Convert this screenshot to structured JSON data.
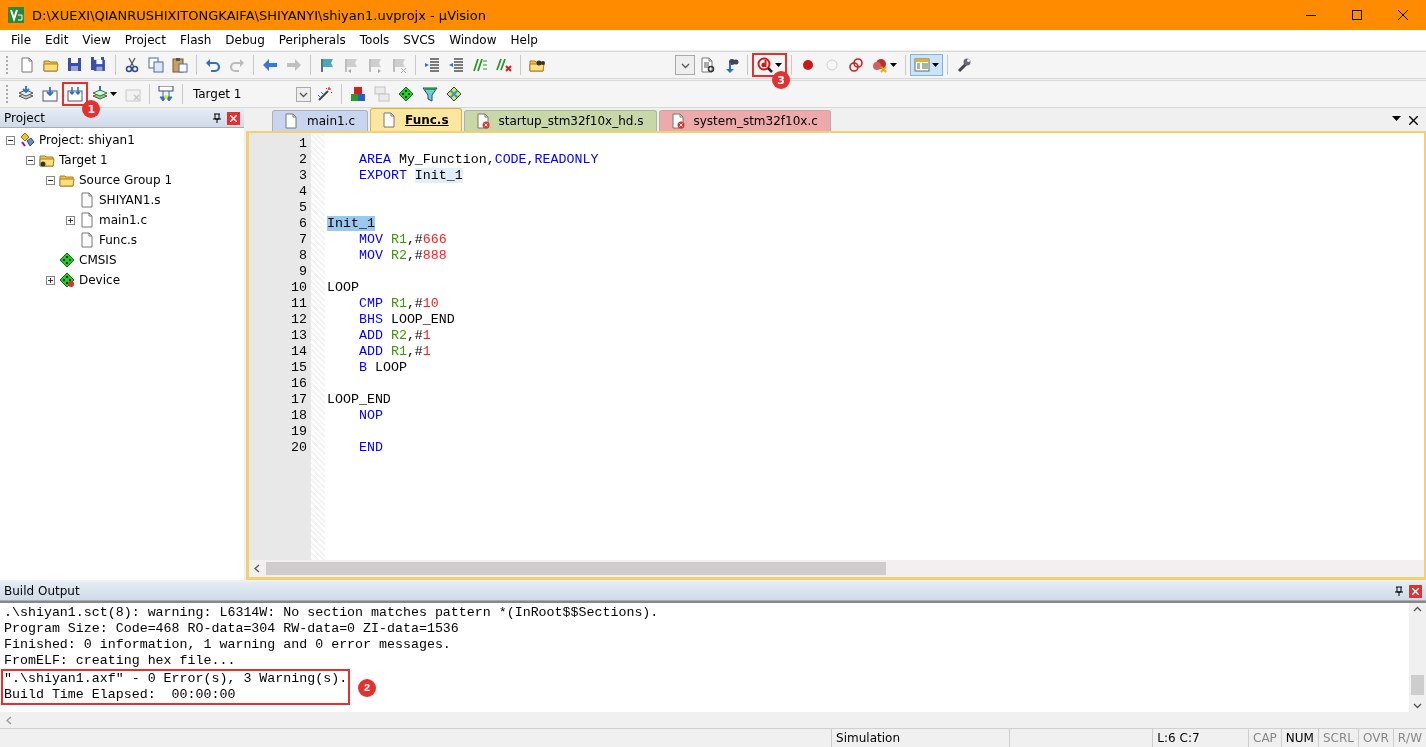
{
  "window": {
    "title": "D:\\XUEXI\\QIANRUSHIXITONGKAIFA\\SHIYANYI\\shiyan1.uvprojx - µVision"
  },
  "menu": [
    "File",
    "Edit",
    "View",
    "Project",
    "Flash",
    "Debug",
    "Peripherals",
    "Tools",
    "SVCS",
    "Window",
    "Help"
  ],
  "toolbar_1": [
    {
      "kind": "button",
      "disabled": false
    },
    {
      "kind": "button",
      "disabled": false
    },
    {
      "kind": "button",
      "disabled": false
    },
    {
      "kind": "button",
      "disabled": false
    },
    {
      "kind": "separator"
    },
    {
      "kind": "button",
      "disabled": false
    },
    {
      "kind": "button",
      "disabled": false
    },
    {
      "kind": "button",
      "disabled": false
    },
    {
      "kind": "separator"
    },
    {
      "kind": "button",
      "disabled": false
    },
    {
      "kind": "button",
      "disabled": true
    },
    {
      "kind": "separator"
    },
    {
      "kind": "button",
      "disabled": false
    },
    {
      "kind": "button",
      "disabled": true
    },
    {
      "kind": "separator"
    },
    {
      "kind": "button",
      "disabled": false
    },
    {
      "kind": "button",
      "disabled": true
    },
    {
      "kind": "button",
      "disabled": true
    },
    {
      "kind": "button",
      "disabled": true
    },
    {
      "kind": "separator"
    },
    {
      "kind": "button",
      "disabled": false
    },
    {
      "kind": "button",
      "disabled": false
    },
    {
      "kind": "button",
      "disabled": false
    },
    {
      "kind": "button",
      "disabled": false
    },
    {
      "kind": "separator"
    },
    {
      "kind": "button",
      "disabled": false
    },
    {
      "kind": "spacer"
    },
    {
      "kind": "combo"
    },
    {
      "kind": "button",
      "disabled": false
    },
    {
      "kind": "button",
      "disabled": false
    },
    {
      "kind": "separator"
    },
    {
      "kind": "split",
      "disabled": false,
      "callout": "3"
    },
    {
      "kind": "separator"
    },
    {
      "kind": "button",
      "disabled": false
    },
    {
      "kind": "button",
      "disabled": true
    },
    {
      "kind": "button",
      "disabled": false
    },
    {
      "kind": "split",
      "disabled": false
    },
    {
      "kind": "separator"
    },
    {
      "kind": "toggle",
      "on": true
    },
    {
      "kind": "separator"
    },
    {
      "kind": "button",
      "disabled": false
    }
  ],
  "toolbar_2": [
    {
      "kind": "button",
      "disabled": false
    },
    {
      "kind": "button",
      "disabled": false
    },
    {
      "kind": "button",
      "disabled": false,
      "callout": "1"
    },
    {
      "kind": "split",
      "disabled": false
    },
    {
      "kind": "button",
      "disabled": true
    },
    {
      "kind": "separator"
    },
    {
      "kind": "button",
      "disabled": false
    },
    {
      "kind": "separator"
    },
    {
      "kind": "target",
      "value": "Target 1"
    },
    {
      "kind": "button",
      "disabled": false
    },
    {
      "kind": "separator"
    },
    {
      "kind": "button",
      "disabled": false
    },
    {
      "kind": "button",
      "disabled": true
    },
    {
      "kind": "button",
      "disabled": false
    },
    {
      "kind": "button",
      "disabled": false
    },
    {
      "kind": "button",
      "disabled": false
    }
  ],
  "project_panel": {
    "title": "Project",
    "tree": [
      {
        "label": "Project: shiyan1",
        "kind": "project",
        "expanded": true,
        "children": [
          {
            "label": "Target 1",
            "kind": "target",
            "expanded": true,
            "children": [
              {
                "label": "Source Group 1",
                "kind": "group",
                "expanded": true,
                "children": [
                  {
                    "label": "SHIYAN1.s",
                    "kind": "file"
                  },
                  {
                    "label": "main1.c",
                    "kind": "file",
                    "expanded": false
                  },
                  {
                    "label": "Func.s",
                    "kind": "file"
                  }
                ]
              },
              {
                "label": "CMSIS",
                "kind": "component"
              },
              {
                "label": "Device",
                "kind": "device",
                "expanded": false
              }
            ]
          }
        ]
      }
    ]
  },
  "editor": {
    "tabs": [
      {
        "label": "main1.c",
        "selected": false,
        "kind": "file",
        "color": "#c9d5ef"
      },
      {
        "label": "Func.s",
        "selected": true,
        "kind": "file",
        "color": "#fde7a0"
      },
      {
        "label": "startup_stm32f10x_hd.s",
        "selected": false,
        "kind": "flagged",
        "color": "#c7d7a6"
      },
      {
        "label": "system_stm32f10x.c",
        "selected": false,
        "kind": "flagged",
        "color": "#eeaaaa"
      }
    ],
    "lines": [
      {
        "number": "1"
      },
      {
        "number": "2",
        "indent": true,
        "tokens": [
          {
            "text": "AREA",
            "kind": "keyword"
          },
          {
            "text": " My_Function,",
            "kind": "plain"
          },
          {
            "text": "CODE",
            "kind": "keyword"
          },
          {
            "text": ",",
            "kind": "plain"
          },
          {
            "text": "READONLY",
            "kind": "keyword"
          }
        ]
      },
      {
        "number": "3",
        "indent": true,
        "tokens": [
          {
            "text": "EXPORT ",
            "kind": "keyword"
          },
          {
            "text": "Init_1",
            "kind": "reference"
          }
        ]
      },
      {
        "number": "4"
      },
      {
        "number": "5"
      },
      {
        "number": "6",
        "indent": false,
        "tokens": [
          {
            "text": "Init_1",
            "kind": "selection"
          }
        ]
      },
      {
        "number": "7",
        "indent": true,
        "tokens": [
          {
            "text": "MOV ",
            "kind": "keyword"
          },
          {
            "text": "R1",
            "kind": "register"
          },
          {
            "text": ",#",
            "kind": "plain"
          },
          {
            "text": "666",
            "kind": "number"
          }
        ]
      },
      {
        "number": "8",
        "indent": true,
        "tokens": [
          {
            "text": "MOV ",
            "kind": "keyword"
          },
          {
            "text": "R2",
            "kind": "register"
          },
          {
            "text": ",#",
            "kind": "plain"
          },
          {
            "text": "888",
            "kind": "number"
          }
        ]
      },
      {
        "number": "9"
      },
      {
        "number": "10",
        "indent": false,
        "tokens": [
          {
            "text": "LOOP",
            "kind": "plain"
          }
        ]
      },
      {
        "number": "11",
        "indent": true,
        "tokens": [
          {
            "text": "CMP ",
            "kind": "keyword"
          },
          {
            "text": "R1",
            "kind": "register"
          },
          {
            "text": ",#",
            "kind": "plain"
          },
          {
            "text": "10",
            "kind": "number"
          }
        ]
      },
      {
        "number": "12",
        "indent": true,
        "tokens": [
          {
            "text": "BHS",
            "kind": "keyword"
          },
          {
            "text": " LOOP_END",
            "kind": "plain"
          }
        ]
      },
      {
        "number": "13",
        "indent": true,
        "tokens": [
          {
            "text": "ADD ",
            "kind": "keyword"
          },
          {
            "text": "R2",
            "kind": "register"
          },
          {
            "text": ",#",
            "kind": "plain"
          },
          {
            "text": "1",
            "kind": "number"
          }
        ]
      },
      {
        "number": "14",
        "indent": true,
        "tokens": [
          {
            "text": "ADD ",
            "kind": "keyword"
          },
          {
            "text": "R1",
            "kind": "register"
          },
          {
            "text": ",#",
            "kind": "plain"
          },
          {
            "text": "1",
            "kind": "number"
          }
        ]
      },
      {
        "number": "15",
        "indent": true,
        "tokens": [
          {
            "text": "B",
            "kind": "keyword"
          },
          {
            "text": " LOOP",
            "kind": "plain"
          }
        ]
      },
      {
        "number": "16"
      },
      {
        "number": "17",
        "indent": false,
        "tokens": [
          {
            "text": "LOOP_END",
            "kind": "plain"
          }
        ]
      },
      {
        "number": "18",
        "indent": true,
        "tokens": [
          {
            "text": "NOP",
            "kind": "keyword"
          }
        ]
      },
      {
        "number": "19"
      },
      {
        "number": "20",
        "indent": true,
        "tokens": [
          {
            "text": "END",
            "kind": "keyword"
          }
        ]
      }
    ]
  },
  "build_output": {
    "title": "Build Output",
    "lines": [
      ".\\shiyan1.sct(8): warning: L6314W: No section matches pattern *(InRoot$$Sections).",
      "Program Size: Code=468 RO-data=304 RW-data=0 ZI-data=1536",
      "Finished: 0 information, 1 warning and 0 error messages.",
      "FromELF: creating hex file..."
    ],
    "highlighted": {
      "callout": "2",
      "lines": [
        "\".\\shiyan1.axf\" - 0 Error(s), 3 Warning(s).",
        "Build Time Elapsed:  00:00:00"
      ]
    }
  },
  "status_bar": {
    "mode": "Simulation",
    "position": "L:6 C:7",
    "indicators": [
      {
        "label": "CAP",
        "on": false
      },
      {
        "label": "NUM",
        "on": true
      },
      {
        "label": "SCRL",
        "on": false
      },
      {
        "label": "OVR",
        "on": false
      },
      {
        "label": "R/W",
        "on": false
      }
    ]
  }
}
